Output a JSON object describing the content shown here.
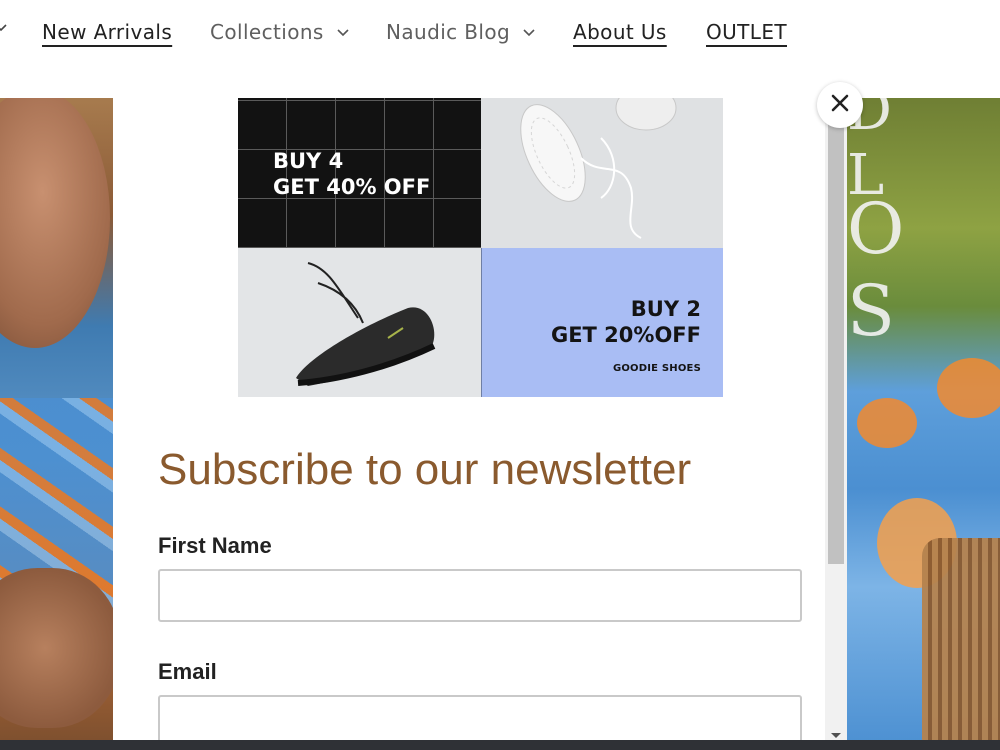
{
  "nav": {
    "items": [
      {
        "label": "New Arrivals",
        "has_dropdown": false
      },
      {
        "label": "Collections",
        "has_dropdown": true
      },
      {
        "label": "Naudic Blog",
        "has_dropdown": true
      },
      {
        "label": "About Us",
        "has_dropdown": false
      },
      {
        "label": "OUTLET",
        "has_dropdown": false
      }
    ]
  },
  "modal": {
    "promo": {
      "tile1_line1": "BUY 4",
      "tile1_line2": "GET 40% OFF",
      "tile4_line1": "BUY 2",
      "tile4_line2": "GET 20%OFF",
      "tile4_brand": "GOODIE SHOES"
    },
    "newsletter": {
      "title": "Subscribe to our newsletter",
      "first_name_label": "First Name",
      "first_name_value": "",
      "email_label": "Email",
      "email_value": ""
    },
    "close_icon": "close-icon"
  },
  "colors": {
    "title_brown": "#8a5a2e",
    "promo_blue": "#a9bdf4",
    "promo_black": "#121212"
  },
  "hero": {
    "letters_top": "D  L",
    "letters": "O S"
  }
}
